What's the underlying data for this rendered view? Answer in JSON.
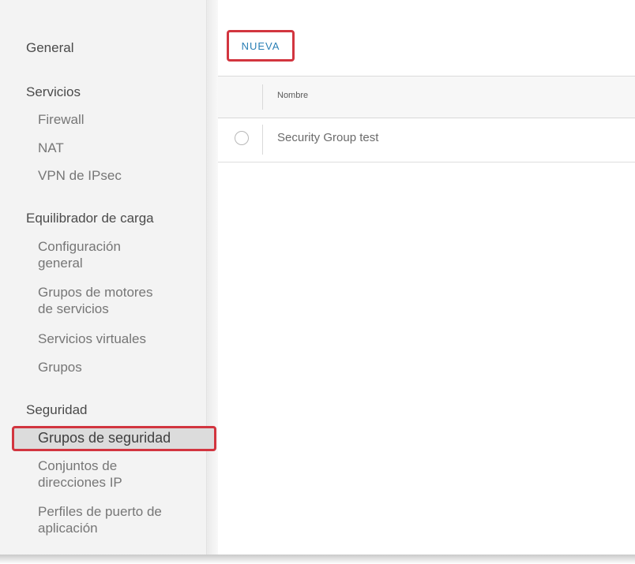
{
  "sidebar": {
    "general": "General",
    "services": "Servicios",
    "firewall": "Firewall",
    "nat": "NAT",
    "vpn_ipsec": "VPN de IPsec",
    "load_balancer": "Equilibrador de carga",
    "config_line1": "Configuración",
    "config_line2": "general",
    "service_engine_line1": "Grupos de motores",
    "service_engine_line2": "de servicios",
    "virtual_services": "Servicios virtuales",
    "groups": "Grupos",
    "security": "Seguridad",
    "security_groups": "Grupos de seguridad",
    "ip_sets_line1": "Conjuntos de",
    "ip_sets_line2": "direcciones IP",
    "app_port_profiles_line1": "Perfiles de puerto de",
    "app_port_profiles_line2": "aplicación"
  },
  "main": {
    "new_button": "NUEVA",
    "grid": {
      "header_name": "Nombre",
      "rows": [
        {
          "name": "Security Group test"
        }
      ]
    }
  },
  "colors": {
    "highlight_border": "#d2353f",
    "link_blue": "#2a7fb5"
  }
}
